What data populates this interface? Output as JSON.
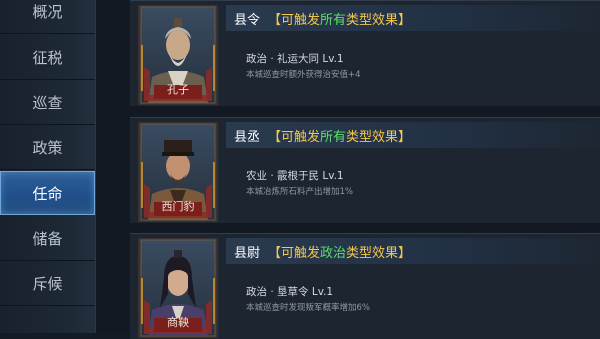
{
  "sidebar": {
    "items": [
      {
        "label": "概况"
      },
      {
        "label": "征税"
      },
      {
        "label": "巡查"
      },
      {
        "label": "政策"
      },
      {
        "label": "任命",
        "active": true
      },
      {
        "label": "储备"
      },
      {
        "label": "斥候"
      }
    ]
  },
  "cards": [
    {
      "name": "孔子",
      "role": "县令",
      "effect_pre": "【可触发",
      "effect_hl": "所有",
      "effect_post": "类型效果】",
      "skill": "政治 · 礼运大同  Lv.1",
      "desc": "本城巡查时额外获得治安值+4",
      "portrait_icon": "confucius-portrait"
    },
    {
      "name": "西门豹",
      "role": "县丞",
      "effect_pre": "【可触发",
      "effect_hl": "所有",
      "effect_post": "类型效果】",
      "skill": "农业 · 霰根于民  Lv.1",
      "desc": "本城冶炼所石料产出增加1%",
      "portrait_icon": "ximen-bao-portrait"
    },
    {
      "name": "商鞅",
      "role": "县尉",
      "effect_pre": "【可触发",
      "effect_hl": "政治",
      "effect_post": "类型效果】",
      "skill": "政治 · 垦草令  Lv.1",
      "desc": "本城巡查时发现叛军概率增加6%",
      "portrait_icon": "shang-yang-portrait"
    }
  ],
  "colors": {
    "accent_active": "#2f5f97",
    "highlight_green": "#5be06a",
    "bracket_gold": "#f2c94c",
    "portrait_frame_red": "#8e2a26"
  }
}
